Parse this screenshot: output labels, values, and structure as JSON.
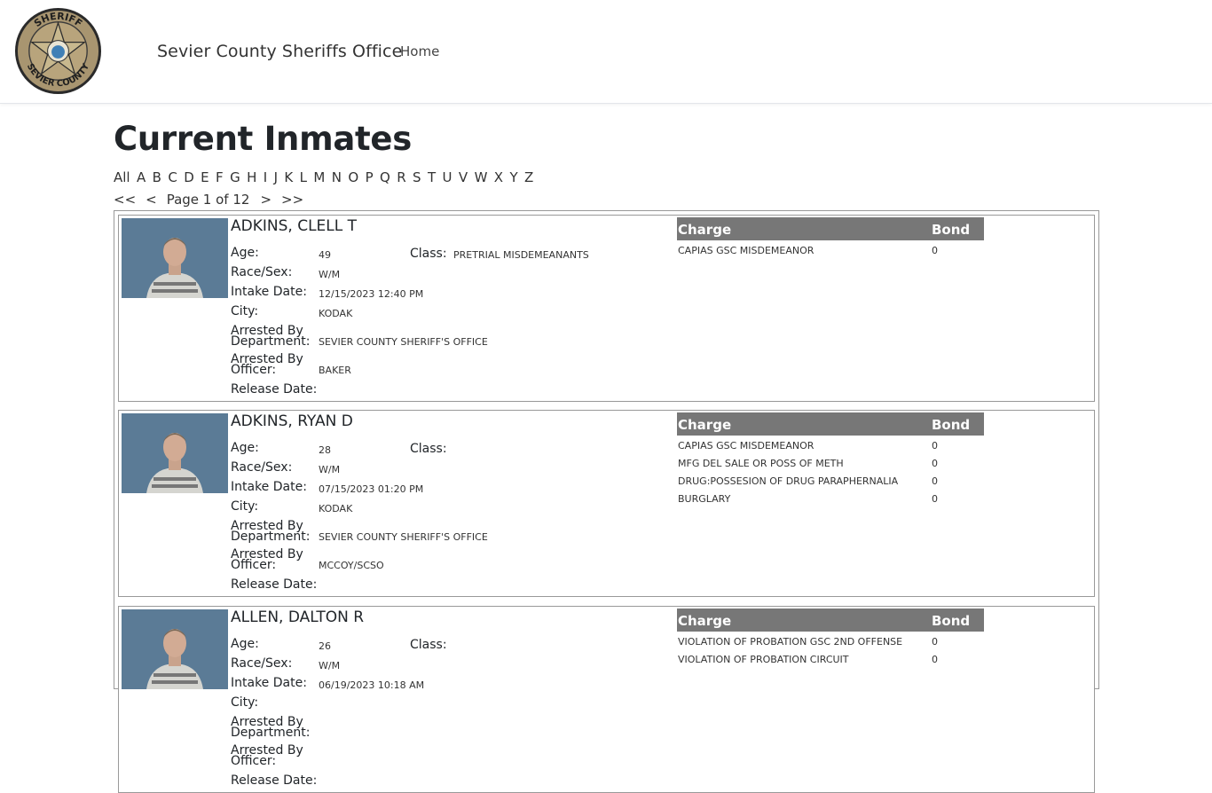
{
  "nav": {
    "logo_top_text": "SHERIFF",
    "logo_bottom_text": "SEVIER COUNTY",
    "brand": "Sevier County Sheriffs Office",
    "home": "Home"
  },
  "page": {
    "title": "Current Inmates",
    "letters": [
      "All",
      "A",
      "B",
      "C",
      "D",
      "E",
      "F",
      "G",
      "H",
      "I",
      "J",
      "K",
      "L",
      "M",
      "N",
      "O",
      "P",
      "Q",
      "R",
      "S",
      "T",
      "U",
      "V",
      "W",
      "X",
      "Y",
      "Z"
    ],
    "pager": {
      "first": "<<",
      "prev": "<",
      "page_text": "Page 1 of 12",
      "next": ">",
      "last": ">>"
    }
  },
  "labels": {
    "age": "Age:",
    "race_sex": "Race/Sex:",
    "intake": "Intake Date:",
    "city": "City:",
    "arrested_dept_1": "Arrested By",
    "arrested_dept_2": "Department:",
    "arrested_off_1": "Arrested By",
    "arrested_off_2": "Officer:",
    "release": "Release Date:",
    "class": "Class:",
    "charge": "Charge",
    "bond": "Bond"
  },
  "inmates": [
    {
      "name": "ADKINS, CLELL T",
      "age": "49",
      "class": "PRETRIAL MISDEMEANANTS",
      "race_sex": "W/M",
      "intake": "12/15/2023 12:40 PM",
      "city": "KODAK",
      "department": "SEVIER COUNTY SHERIFF'S OFFICE",
      "officer": "BAKER",
      "release": "",
      "charges": [
        {
          "charge": "CAPIAS GSC MISDEMEANOR",
          "bond": "0"
        }
      ]
    },
    {
      "name": "ADKINS, RYAN D",
      "age": "28",
      "class": "",
      "race_sex": "W/M",
      "intake": "07/15/2023 01:20 PM",
      "city": "KODAK",
      "department": "SEVIER COUNTY SHERIFF'S OFFICE",
      "officer": "MCCOY/SCSO",
      "release": "",
      "charges": [
        {
          "charge": "CAPIAS GSC MISDEMEANOR",
          "bond": "0"
        },
        {
          "charge": "MFG DEL SALE OR POSS OF METH",
          "bond": "0"
        },
        {
          "charge": "DRUG:POSSESION OF DRUG PARAPHERNALIA",
          "bond": "0"
        },
        {
          "charge": "BURGLARY",
          "bond": "0"
        }
      ]
    },
    {
      "name": "ALLEN, DALTON R",
      "age": "26",
      "class": "",
      "race_sex": "W/M",
      "intake": "06/19/2023 10:18 AM",
      "city": "",
      "department": "",
      "officer": "",
      "release": "",
      "charges": [
        {
          "charge": "VIOLATION OF PROBATION GSC 2ND OFFENSE",
          "bond": "0"
        },
        {
          "charge": "VIOLATION OF PROBATION CIRCUIT",
          "bond": "0"
        }
      ]
    }
  ]
}
